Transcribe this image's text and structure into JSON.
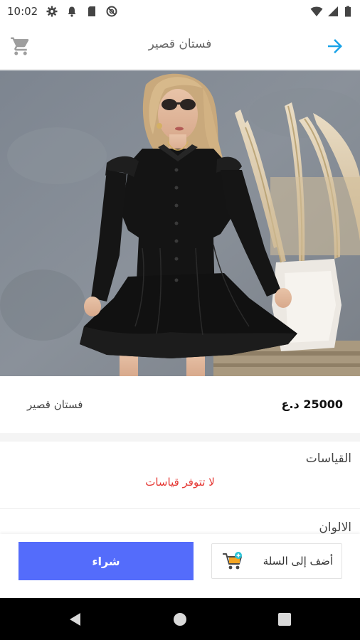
{
  "status_bar": {
    "time": "10:02",
    "icons_left": [
      "settings-icon",
      "notification-icon",
      "sd-card-icon",
      "no-data-icon"
    ],
    "icons_right": [
      "wifi-icon",
      "signal-icon",
      "battery-icon"
    ]
  },
  "app_bar": {
    "title": "فستان قصير",
    "back_icon": "arrow-right-icon",
    "cart_icon": "cart-icon",
    "accent_color": "#1aa3e8"
  },
  "product": {
    "image_alt": "product-photo",
    "price": "25000 د.ع",
    "name": "فستان قصير"
  },
  "sizes": {
    "title": "القياسات",
    "empty_message": "لا تتوفر قياسات",
    "empty_color": "#e53935"
  },
  "colors": {
    "title": "الالوان"
  },
  "actions": {
    "buy_label": "شراء",
    "add_to_cart_label": "أضف إلى السلة",
    "buy_color": "#546cfb"
  },
  "nav": {
    "back": "nav-back-icon",
    "home": "nav-home-icon",
    "recents": "nav-recents-icon"
  }
}
